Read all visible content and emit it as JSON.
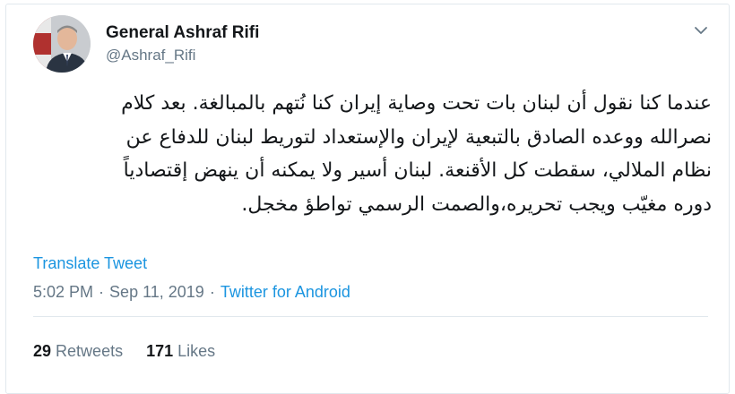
{
  "author": {
    "display_name": "General Ashraf Rifi",
    "handle": "@Ashraf_Rifi",
    "avatar_icon": "profile-photo"
  },
  "tweet": {
    "lines": [
      "عندما كنا نقول أن لبنان بات تحت وصاية إيران كنا نُتهم بالمبالغة. بعد كلام",
      "نصرالله ووعده الصادق بالتبعية لإيران والإستعداد لتوريط لبنان للدفاع عن",
      "نظام الملالي، سقطت كل الأقنعة. لبنان أسير  ولا يمكنه أن ينهض إقتصادياً",
      "دوره مغيّب ويجب تحريره،والصمت الرسمي تواطؤ مخجل."
    ],
    "translate_label": "Translate Tweet",
    "time": "5:02 PM",
    "separator": "·",
    "date": "Sep 11, 2019",
    "source": "Twitter for Android"
  },
  "stats": {
    "retweets_count": "29",
    "retweets_label": "Retweets",
    "likes_count": "171",
    "likes_label": "Likes"
  },
  "menu_icon": "chevron-down-icon",
  "colors": {
    "link": "#1b95e0",
    "secondary_text": "#657786",
    "primary_text": "#14171a",
    "border": "#e1e8ed"
  }
}
